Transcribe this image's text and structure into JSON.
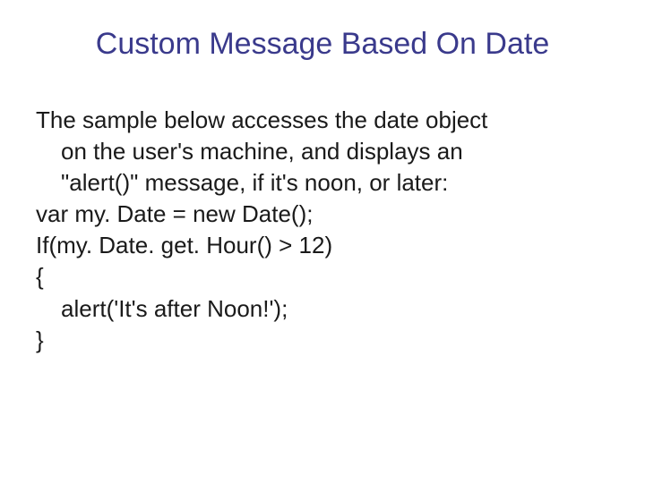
{
  "slide": {
    "title": "Custom Message Based On Date",
    "intro_line1": "The sample below accesses the date object",
    "intro_line2": "on the user's machine, and displays an",
    "intro_line3": "\"alert()\" message, if it's noon, or later:",
    "code_line1": "var my. Date = new Date();",
    "code_line2": "If(my. Date. get. Hour() > 12)",
    "code_line3": "{",
    "code_line4": "alert('It's after Noon!');",
    "code_line5": "}"
  }
}
